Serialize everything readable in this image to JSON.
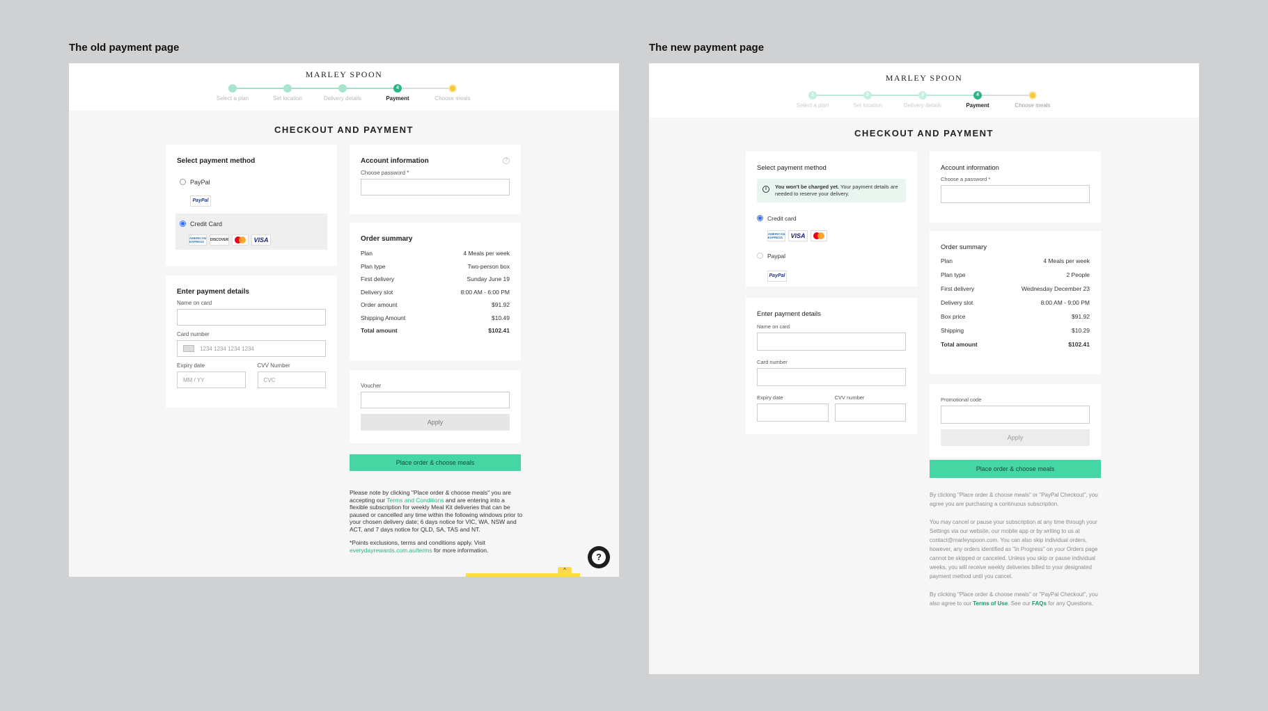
{
  "old": {
    "panel_title": "The old payment page",
    "brand": "MARLEY SPOON",
    "steps": [
      {
        "num": "",
        "label": "Select a plan",
        "state": "done"
      },
      {
        "num": "",
        "label": "Set location",
        "state": "done"
      },
      {
        "num": "",
        "label": "Delivery details",
        "state": "done"
      },
      {
        "num": "4",
        "label": "Payment",
        "state": "active"
      },
      {
        "num": "",
        "label": "Choose meals",
        "state": "pending"
      }
    ],
    "heading": "CHECKOUT AND PAYMENT",
    "payment_method": {
      "title": "Select payment method",
      "paypal_label": "PayPal",
      "paypal_logo": "PayPal",
      "credit_label": "Credit Card",
      "card_logos": {
        "amex": "AMERICAN EXPRESS",
        "discover": "DISCOVER",
        "visa": "VISA"
      }
    },
    "payment_details": {
      "title": "Enter payment details",
      "name_label": "Name on card",
      "card_label": "Card number",
      "card_placeholder": "1234 1234 1234 1234",
      "expiry_label": "Expiry date",
      "expiry_placeholder": "MM / YY",
      "cvv_label": "CVV Number",
      "cvv_placeholder": "CVC"
    },
    "account": {
      "title": "Account information",
      "help": "?",
      "password_label": "Choose password *"
    },
    "summary": {
      "title": "Order summary",
      "rows": [
        {
          "label": "Plan",
          "value": "4 Meals per week"
        },
        {
          "label": "Plan type",
          "value": "Two-person box"
        },
        {
          "label": "First delivery",
          "value": "Sunday June 19"
        },
        {
          "label": "Delivery slot",
          "value": "8:00 AM - 6:00 PM"
        },
        {
          "label": "Order amount",
          "value": "$91.92"
        },
        {
          "label": "Shipping Amount",
          "value": "$10.49"
        },
        {
          "label": "Total amount",
          "value": "$102.41"
        }
      ]
    },
    "voucher": {
      "label": "Voucher",
      "apply": "Apply"
    },
    "place_order": "Place order & choose meals",
    "legal": {
      "p1_a": "Please note by clicking \"Place order & choose meals\" you are accepting our ",
      "p1_link": "Terms and Conditions",
      "p1_b": " and are entering into a flexible subscription for weekly Meal Kit deliveries that can be paused or cancelled any time within the following windows prior to your chosen delivery date; 6 days notice for VIC, WA, NSW and ACT, and 7 days notice for QLD, SA, TAS and NT.",
      "p2_a": "*Points exclusions, terms and conditions apply. Visit ",
      "p2_link": "everydayrewards.com.au/terms",
      "p2_b": " for more information."
    },
    "chat": "?",
    "chevron": "^"
  },
  "new": {
    "panel_title": "The new payment page",
    "brand": "MARLEY SPOON",
    "steps": [
      {
        "num": "1",
        "label": "Select a plan",
        "state": "done"
      },
      {
        "num": "2",
        "label": "Set location",
        "state": "done"
      },
      {
        "num": "3",
        "label": "Delivery details",
        "state": "done"
      },
      {
        "num": "4",
        "label": "Payment",
        "state": "active"
      },
      {
        "num": "",
        "label": "Choose meals",
        "state": "pending"
      }
    ],
    "heading": "CHECKOUT AND PAYMENT",
    "payment_method": {
      "title": "Select payment method",
      "info_icon": "i",
      "info_bold": "You won't be charged yet.",
      "info_text": " Your payment details are needed to reserve your delivery.",
      "credit_label": "Credit card",
      "card_logos": {
        "amex": "AMERICAN EXPRESS",
        "visa": "VISA"
      },
      "paypal_label": "Paypal",
      "paypal_logo": "PayPal"
    },
    "payment_details": {
      "title": "Enter payment details",
      "name_label": "Name on card",
      "card_label": "Card number",
      "expiry_label": "Expiry date",
      "cvv_label": "CVV number"
    },
    "account": {
      "title": "Account information",
      "password_label": "Choose a password *"
    },
    "summary": {
      "title": "Order summary",
      "rows": [
        {
          "label": "Plan",
          "value": "4 Meals per week"
        },
        {
          "label": "Plan type",
          "value": "2 People"
        },
        {
          "label": "First delivery",
          "value": "Wednesday December 23"
        },
        {
          "label": "Delivery slot",
          "value": "8:00 AM - 9:00 PM"
        },
        {
          "label": "Box price",
          "value": "$91.92"
        },
        {
          "label": "Shipping",
          "value": "$10.29"
        },
        {
          "label": "Total amount",
          "value": "$102.41"
        }
      ]
    },
    "promo": {
      "label": "Promotional code",
      "apply": "Apply"
    },
    "place_order": "Place order & choose meals",
    "legal": {
      "p1": "By clicking \"Place order & choose meals\" or \"PayPal Checkout\", you agree you are purchasing a continuous subscription.",
      "p2": "You may cancel or pause your subscription at any time through your Settings via our website, our mobile app or by writing to us at contact@marleyspoon.com. You can also skip individual orders, however, any orders identified as \"In Progress\" on your Orders page cannot be skipped or canceled. Unless you skip or pause individual weeks, you will receive weekly deliveries billed to your designated payment method until you cancel.",
      "p3_a": "By clicking \"Place order & choose meals\" or \"PayPal Checkout\", you also agree to our ",
      "p3_link1": "Terms of Use",
      "p3_b": ". See our ",
      "p3_link2": "FAQs",
      "p3_c": " for any Questions."
    }
  }
}
